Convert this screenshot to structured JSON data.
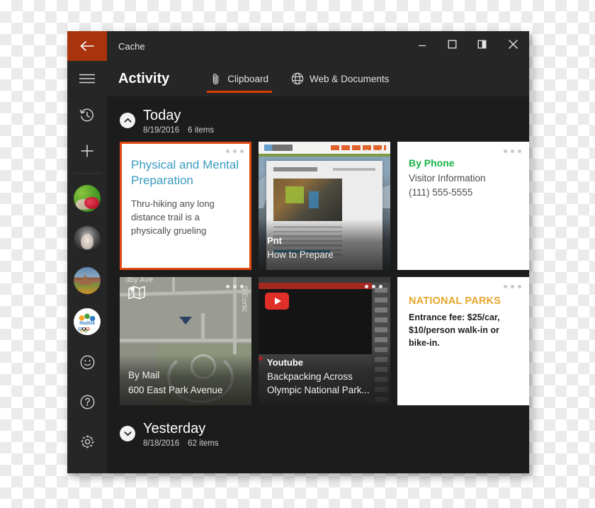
{
  "window": {
    "title": "Cache",
    "back_icon": "back-arrow-icon",
    "controls": [
      {
        "name": "minimize-button",
        "icon": "minimize-icon"
      },
      {
        "name": "maximize-button",
        "icon": "maximize-icon"
      },
      {
        "name": "snap-button",
        "icon": "split-screen-icon"
      },
      {
        "name": "close-button",
        "icon": "close-icon"
      }
    ]
  },
  "rail": {
    "items": [
      {
        "name": "menu-button",
        "icon": "hamburger-icon"
      },
      {
        "name": "history-button",
        "icon": "history-clock-icon"
      },
      {
        "name": "add-button",
        "icon": "plus-icon"
      }
    ],
    "avatars": [
      {
        "name": "avatar-vegetables",
        "label": "Vegetables"
      },
      {
        "name": "avatar-portrait",
        "label": "Portrait"
      },
      {
        "name": "avatar-landscape",
        "label": "Landscape"
      },
      {
        "name": "avatar-rio2016",
        "label": "Rio 2016",
        "text": "Rio2016"
      }
    ],
    "bottom": [
      {
        "name": "feedback-button",
        "icon": "smiley-icon"
      },
      {
        "name": "help-button",
        "icon": "question-mark-icon"
      },
      {
        "name": "settings-button",
        "icon": "gear-icon"
      }
    ]
  },
  "header": {
    "page_title": "Activity",
    "tabs": [
      {
        "label": "Clipboard",
        "icon": "paperclip-icon",
        "active": true
      },
      {
        "label": "Web & Documents",
        "icon": "globe-icon",
        "active": false
      }
    ]
  },
  "sections": [
    {
      "title": "Today",
      "date": "8/19/2016",
      "count": "6 items",
      "expanded": true,
      "chevron": "chevron-up-icon"
    },
    {
      "title": "Yesterday",
      "date": "8/18/2016",
      "count": "62 items",
      "expanded": false,
      "chevron": "chevron-down-icon"
    }
  ],
  "cards": [
    {
      "name": "card-physical-mental-preparation",
      "selected": true,
      "heading": "Physical and Mental Preparation",
      "body": "Thru-hiking any long distance trail is a physically grueling"
    },
    {
      "name": "card-how-to-prepare",
      "source": "Pnt",
      "title": "How to Prepare",
      "page_heading": "How to Prepare"
    },
    {
      "name": "card-by-phone",
      "heading": "By Phone",
      "line1": "Visitor Information",
      "line2": "(111) 555-5555"
    },
    {
      "name": "card-by-mail",
      "source": "By Mail",
      "title": "600 East Park Avenue",
      "street_1": "dby Ave",
      "street_2": "S Eonic"
    },
    {
      "name": "card-youtube",
      "source": "Youtube",
      "title": "Backpacking Across Olympic National Park..."
    },
    {
      "name": "card-national-parks",
      "heading": "NATIONAL PARKS",
      "body": "Entrance fee: $25/car, $10/person walk-in or bike-in."
    }
  ],
  "colors": {
    "accent": "#e03c04",
    "back_button": "#a8330c",
    "window_chrome": "#262626",
    "content_bg": "#1c1c1c",
    "selection": "#e24a13",
    "card_heading_blue": "#3a9bc1",
    "card_heading_green": "#19b347",
    "card_heading_orange": "#e5a62c"
  }
}
